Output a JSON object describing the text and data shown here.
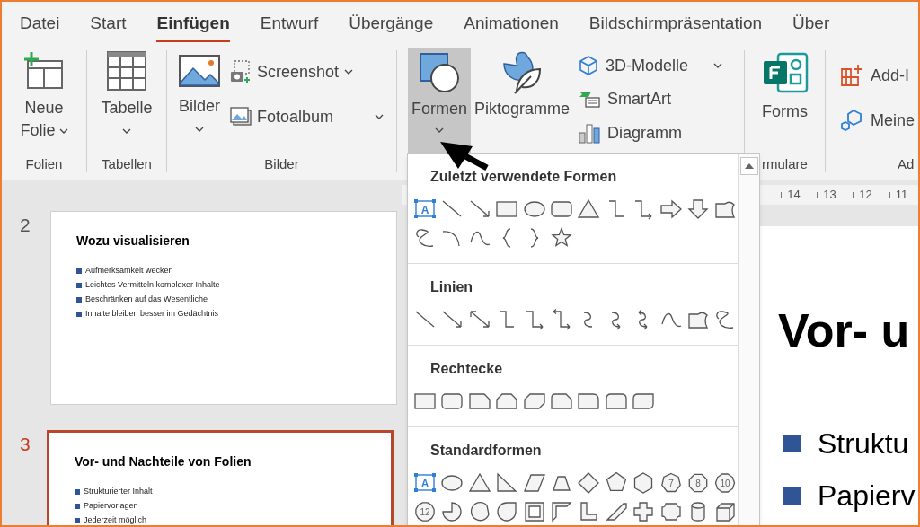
{
  "tabs": [
    {
      "label": "Datei",
      "selected": false
    },
    {
      "label": "Start",
      "selected": false
    },
    {
      "label": "Einfügen",
      "selected": true
    },
    {
      "label": "Entwurf",
      "selected": false
    },
    {
      "label": "Übergänge",
      "selected": false
    },
    {
      "label": "Animationen",
      "selected": false
    },
    {
      "label": "Bildschirmpräsentation",
      "selected": false
    },
    {
      "label": "Über",
      "selected": false
    }
  ],
  "ribbon": {
    "new_slide": [
      "Neue",
      "Folie"
    ],
    "folien_label": "Folien",
    "table": "Tabelle",
    "tabellen_label": "Tabellen",
    "pictures": "Bilder",
    "screenshot": "Screenshot",
    "photo_album": "Fotoalbum",
    "bilder_label": "Bilder",
    "shapes": {
      "label": "Formen",
      "selected": true
    },
    "icons": "Piktogramme",
    "models_3d": "3D-Modelle",
    "smartart": "SmartArt",
    "chart": "Diagramm",
    "forms": "Forms",
    "formulare_label": "rmulare",
    "addins": "Add-I",
    "my_addins": "Meine",
    "addins_label": "Ad"
  },
  "slides": [
    {
      "number": "2",
      "selected": false,
      "title": "Wozu visualisieren",
      "bullets": [
        "Aufmerksamkeit wecken",
        "Leichtes Vermitteln komplexer Inhalte",
        "Beschränken auf das Wesentliche",
        "Inhalte bleiben besser im Gedächtnis"
      ]
    },
    {
      "number": "3",
      "selected": true,
      "title": "Vor- und Nachteile von Folien",
      "bullets": [
        "Strukturierter Inhalt",
        "Papiervorlagen",
        "Jederzeit möglich"
      ]
    }
  ],
  "ruler": [
    "14",
    "13",
    "12",
    "11"
  ],
  "slide": {
    "title": "Vor- u",
    "bullets": [
      "Struktu",
      "Papierv"
    ]
  },
  "shapes_menu": {
    "sections": [
      {
        "title": "Zuletzt verwendete Formen",
        "shapes": [
          {
            "kind": "textbox",
            "label": "A"
          },
          {
            "kind": "line"
          },
          {
            "kind": "arrowline"
          },
          {
            "kind": "rect"
          },
          {
            "kind": "ellipse"
          },
          {
            "kind": "roundrect"
          },
          {
            "kind": "triangle"
          },
          {
            "kind": "elbow"
          },
          {
            "kind": "elbowarrow"
          },
          {
            "kind": "rightarrow"
          },
          {
            "kind": "downarrow"
          },
          {
            "kind": "freeform"
          },
          {
            "kind": "scribble"
          },
          {
            "kind": "arc"
          },
          {
            "kind": "curve"
          },
          {
            "kind": "bracel"
          },
          {
            "kind": "bracer"
          },
          {
            "kind": "star"
          }
        ]
      },
      {
        "title": "Linien",
        "shapes": [
          {
            "kind": "line"
          },
          {
            "kind": "arrowline"
          },
          {
            "kind": "dblarrow"
          },
          {
            "kind": "elbow"
          },
          {
            "kind": "elbowarrow"
          },
          {
            "kind": "elbowdbl"
          },
          {
            "kind": "curvedconn"
          },
          {
            "kind": "curvedarrow"
          },
          {
            "kind": "curveddbl"
          },
          {
            "kind": "curve"
          },
          {
            "kind": "freeform"
          },
          {
            "kind": "scribble"
          }
        ]
      },
      {
        "title": "Rechtecke",
        "shapes": [
          {
            "kind": "rect"
          },
          {
            "kind": "roundrect"
          },
          {
            "kind": "snip1"
          },
          {
            "kind": "snip2same"
          },
          {
            "kind": "snip2diag"
          },
          {
            "kind": "sniprounded"
          },
          {
            "kind": "round1"
          },
          {
            "kind": "round2same"
          },
          {
            "kind": "round2diag"
          }
        ]
      },
      {
        "title": "Standardformen",
        "shapes": [
          {
            "kind": "textbox",
            "label": "A"
          },
          {
            "kind": "ellipse"
          },
          {
            "kind": "triangle"
          },
          {
            "kind": "rtriangle"
          },
          {
            "kind": "parallelogram"
          },
          {
            "kind": "trapezoid"
          },
          {
            "kind": "diamond"
          },
          {
            "kind": "pentagon"
          },
          {
            "kind": "hexagon"
          },
          {
            "kind": "heptagon",
            "label": "7"
          },
          {
            "kind": "octagon",
            "label": "8"
          },
          {
            "kind": "decagon",
            "label": "10"
          },
          {
            "kind": "dodecagon",
            "label": "12"
          },
          {
            "kind": "pie"
          },
          {
            "kind": "chord"
          },
          {
            "kind": "teardrop"
          },
          {
            "kind": "frame"
          },
          {
            "kind": "halfframe"
          },
          {
            "kind": "lshape"
          },
          {
            "kind": "diagstripe"
          },
          {
            "kind": "cross"
          },
          {
            "kind": "plaque"
          },
          {
            "kind": "can"
          },
          {
            "kind": "cube"
          }
        ]
      }
    ]
  }
}
